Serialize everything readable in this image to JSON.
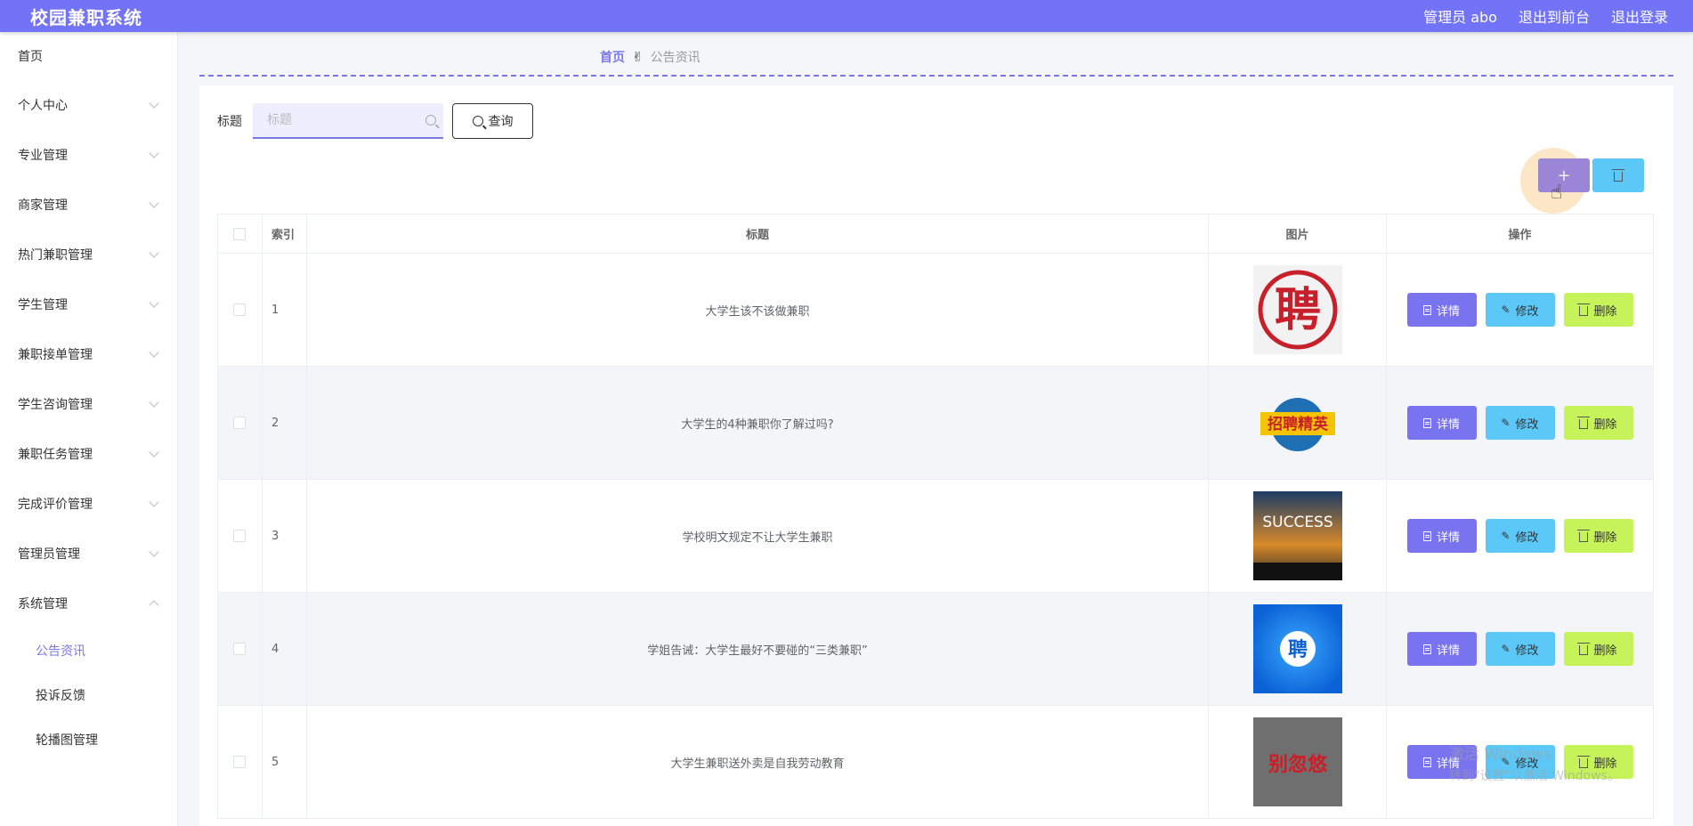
{
  "header": {
    "brand": "校园兼职系统",
    "user_label": "管理员 abo",
    "to_front_label": "退出到前台",
    "logout_label": "退出登录"
  },
  "sidebar": {
    "items": [
      {
        "label": "首页",
        "expandable": false
      },
      {
        "label": "个人中心",
        "expandable": true
      },
      {
        "label": "专业管理",
        "expandable": true
      },
      {
        "label": "商家管理",
        "expandable": true
      },
      {
        "label": "热门兼职管理",
        "expandable": true
      },
      {
        "label": "学生管理",
        "expandable": true
      },
      {
        "label": "兼职接单管理",
        "expandable": true
      },
      {
        "label": "学生咨询管理",
        "expandable": true
      },
      {
        "label": "兼职任务管理",
        "expandable": true
      },
      {
        "label": "完成评价管理",
        "expandable": true
      },
      {
        "label": "管理员管理",
        "expandable": true
      },
      {
        "label": "系统管理",
        "expandable": true,
        "expanded": true
      }
    ],
    "sub_items": [
      {
        "label": "公告资讯",
        "active": true
      },
      {
        "label": "投诉反馈",
        "active": false
      },
      {
        "label": "轮播图管理",
        "active": false
      }
    ]
  },
  "breadcrumb": {
    "home": "首页",
    "separator_icon": "hand-icon",
    "current": "公告资讯"
  },
  "search": {
    "label": "标题",
    "placeholder": "标题",
    "value": "",
    "button_label": "查询"
  },
  "toolbar": {
    "add_icon": "plus-icon",
    "bulk_delete_icon": "trash-icon"
  },
  "table": {
    "columns": [
      "",
      "索引",
      "标题",
      "图片",
      "操作"
    ],
    "actions": {
      "detail": "详情",
      "edit": "修改",
      "delete": "删除"
    },
    "rows": [
      {
        "index": "1",
        "title": "大学生该不该做兼职",
        "image": "聘"
      },
      {
        "index": "2",
        "title": "大学生的4种兼职你了解过吗?",
        "image": "招聘精英"
      },
      {
        "index": "3",
        "title": "学校明文规定不让大学生兼职",
        "image": "SUCCESS"
      },
      {
        "index": "4",
        "title": "学姐告诫：大学生最好不要碰的“三类兼职”",
        "image": "聘"
      },
      {
        "index": "5",
        "title": "大学生兼职送外卖是自我劳动教育",
        "image": "别忽悠"
      }
    ]
  },
  "colors": {
    "header_bg": "#7373f7",
    "accent": "#7a78e6",
    "detail_btn": "#7a73f0",
    "edit_btn": "#5cc8f7",
    "delete_btn": "#c6f25a"
  },
  "watermark": {
    "line1": "激活 Windows",
    "line2": "转到\"设置\"以激活 Windows。"
  }
}
